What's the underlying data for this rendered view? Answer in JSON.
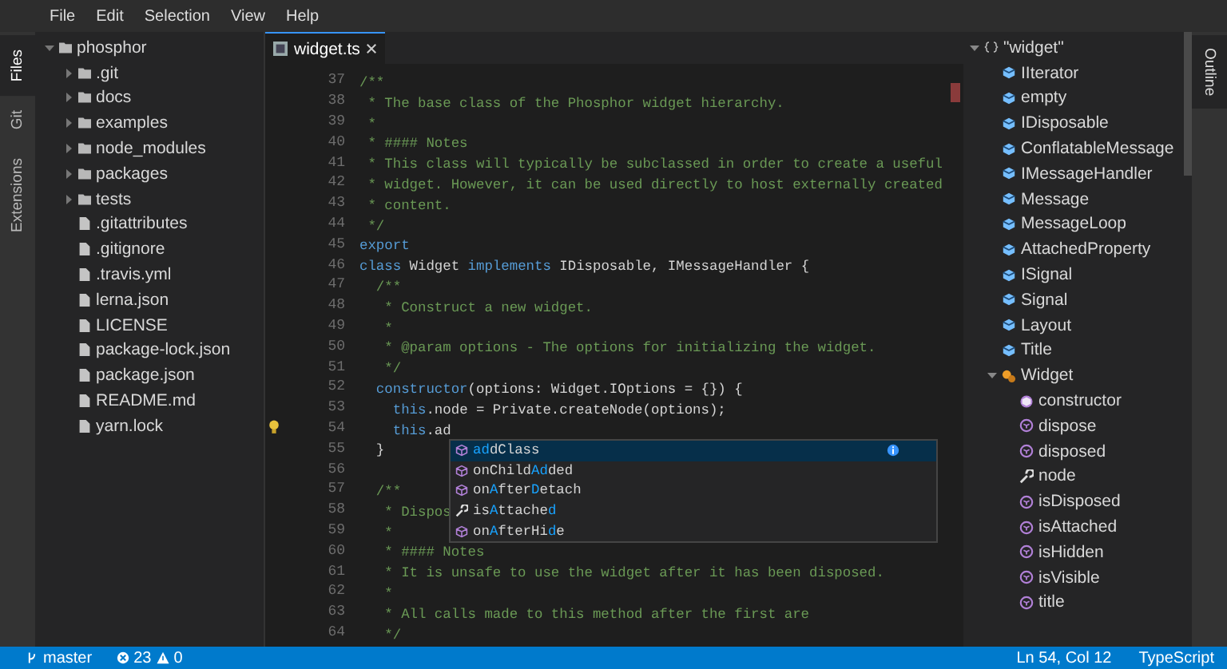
{
  "menu": [
    "File",
    "Edit",
    "Selection",
    "View",
    "Help"
  ],
  "activity_tabs": [
    {
      "label": "Files",
      "selected": true
    },
    {
      "label": "Git",
      "selected": false
    },
    {
      "label": "Extensions",
      "selected": false
    }
  ],
  "explorer": {
    "name": "phosphor",
    "kind": "folder",
    "expanded": true,
    "children": [
      {
        "name": ".git",
        "kind": "folder",
        "expanded": false
      },
      {
        "name": "docs",
        "kind": "folder",
        "expanded": false
      },
      {
        "name": "examples",
        "kind": "folder",
        "expanded": false
      },
      {
        "name": "node_modules",
        "kind": "folder",
        "expanded": false
      },
      {
        "name": "packages",
        "kind": "folder",
        "expanded": false
      },
      {
        "name": "tests",
        "kind": "folder",
        "expanded": false
      },
      {
        "name": ".gitattributes",
        "kind": "file"
      },
      {
        "name": ".gitignore",
        "kind": "file"
      },
      {
        "name": ".travis.yml",
        "kind": "file"
      },
      {
        "name": "lerna.json",
        "kind": "file"
      },
      {
        "name": "LICENSE",
        "kind": "file"
      },
      {
        "name": "package-lock.json",
        "kind": "file"
      },
      {
        "name": "package.json",
        "kind": "file"
      },
      {
        "name": "README.md",
        "kind": "file"
      },
      {
        "name": "yarn.lock",
        "kind": "file"
      }
    ]
  },
  "editor": {
    "tabs": [
      {
        "label": "widget.ts",
        "selected": true
      }
    ],
    "lines": [
      {
        "number": "37",
        "lightbulb": false,
        "tokens": [
          {
            "text": "/**",
            "kind": "comment"
          }
        ]
      },
      {
        "number": "38",
        "lightbulb": false,
        "tokens": [
          {
            "text": " * The base class of the Phosphor widget hierarchy.",
            "kind": "comment"
          }
        ]
      },
      {
        "number": "39",
        "lightbulb": false,
        "tokens": [
          {
            "text": " *",
            "kind": "comment"
          }
        ]
      },
      {
        "number": "40",
        "lightbulb": false,
        "tokens": [
          {
            "text": " * #### Notes",
            "kind": "comment"
          }
        ]
      },
      {
        "number": "41",
        "lightbulb": false,
        "tokens": [
          {
            "text": " * This class will typically be subclassed in order to create a useful",
            "kind": "comment"
          }
        ]
      },
      {
        "number": "42",
        "lightbulb": false,
        "tokens": [
          {
            "text": " * widget. However, it can be used directly to host externally created",
            "kind": "comment"
          }
        ]
      },
      {
        "number": "43",
        "lightbulb": false,
        "tokens": [
          {
            "text": " * content.",
            "kind": "comment"
          }
        ]
      },
      {
        "number": "44",
        "lightbulb": false,
        "tokens": [
          {
            "text": " */",
            "kind": "comment"
          }
        ]
      },
      {
        "number": "45",
        "lightbulb": false,
        "tokens": [
          {
            "text": "export",
            "kind": "keyword"
          }
        ]
      },
      {
        "number": "46",
        "lightbulb": false,
        "tokens": [
          {
            "text": "class",
            "kind": "keyword"
          },
          {
            "text": " Widget ",
            "kind": "plain"
          },
          {
            "text": "implements",
            "kind": "keyword"
          },
          {
            "text": " IDisposable, IMessageHandler {",
            "kind": "plain"
          }
        ]
      },
      {
        "number": "47",
        "lightbulb": false,
        "tokens": [
          {
            "text": "  /**",
            "kind": "comment"
          }
        ]
      },
      {
        "number": "48",
        "lightbulb": false,
        "tokens": [
          {
            "text": "   * Construct a new widget.",
            "kind": "comment"
          }
        ]
      },
      {
        "number": "49",
        "lightbulb": false,
        "tokens": [
          {
            "text": "   *",
            "kind": "comment"
          }
        ]
      },
      {
        "number": "50",
        "lightbulb": false,
        "tokens": [
          {
            "text": "   * @param options - The options for initializing the widget.",
            "kind": "comment"
          }
        ]
      },
      {
        "number": "51",
        "lightbulb": false,
        "tokens": [
          {
            "text": "   */",
            "kind": "comment"
          }
        ]
      },
      {
        "number": "52",
        "lightbulb": false,
        "tokens": [
          {
            "text": "  constructor",
            "kind": "keyword"
          },
          {
            "text": "(options: Widget.IOptions = {}) {",
            "kind": "plain"
          }
        ]
      },
      {
        "number": "53",
        "lightbulb": false,
        "tokens": [
          {
            "text": "    this",
            "kind": "keyword"
          },
          {
            "text": ".node = Private.createNode(options);",
            "kind": "plain"
          }
        ]
      },
      {
        "number": "54",
        "lightbulb": true,
        "tokens": [
          {
            "text": "    this",
            "kind": "keyword"
          },
          {
            "text": ".ad",
            "kind": "plain"
          }
        ]
      },
      {
        "number": "55",
        "lightbulb": false,
        "tokens": [
          {
            "text": "  }",
            "kind": "plain"
          }
        ]
      },
      {
        "number": "56",
        "lightbulb": false
      },
      {
        "number": "57",
        "lightbulb": false,
        "tokens": [
          {
            "text": "  /**",
            "kind": "comment"
          }
        ]
      },
      {
        "number": "58",
        "lightbulb": false,
        "tokens": [
          {
            "text": "   * Dispos",
            "kind": "comment"
          }
        ]
      },
      {
        "number": "59",
        "lightbulb": false,
        "tokens": [
          {
            "text": "   *",
            "kind": "comment"
          }
        ]
      },
      {
        "number": "60",
        "lightbulb": false,
        "tokens": [
          {
            "text": "   * #### Notes",
            "kind": "comment"
          }
        ]
      },
      {
        "number": "61",
        "lightbulb": false,
        "tokens": [
          {
            "text": "   * It is unsafe to use the widget after it has been disposed.",
            "kind": "comment"
          }
        ]
      },
      {
        "number": "62",
        "lightbulb": false,
        "tokens": [
          {
            "text": "   *",
            "kind": "comment"
          }
        ]
      },
      {
        "number": "63",
        "lightbulb": false,
        "tokens": [
          {
            "text": "   * All calls made to this method after the first are",
            "kind": "comment"
          }
        ]
      },
      {
        "number": "64",
        "lightbulb": false,
        "tokens": [
          {
            "text": "   */",
            "kind": "comment"
          }
        ]
      }
    ],
    "completions": [
      {
        "kind": "method",
        "selected": true,
        "segments": [
          {
            "text": "ad",
            "match": true
          },
          {
            "text": "dClass",
            "match": false
          }
        ]
      },
      {
        "kind": "method",
        "selected": false,
        "segments": [
          {
            "text": "onChild",
            "match": false
          },
          {
            "text": "Ad",
            "match": true
          },
          {
            "text": "ded",
            "match": false
          }
        ]
      },
      {
        "kind": "method",
        "selected": false,
        "segments": [
          {
            "text": "on",
            "match": false
          },
          {
            "text": "A",
            "match": true
          },
          {
            "text": "fter",
            "match": false
          },
          {
            "text": "D",
            "match": true
          },
          {
            "text": "etach",
            "match": false
          }
        ]
      },
      {
        "kind": "property",
        "selected": false,
        "segments": [
          {
            "text": "is",
            "match": false
          },
          {
            "text": "A",
            "match": true
          },
          {
            "text": "ttache",
            "match": false
          },
          {
            "text": "d",
            "match": true
          }
        ]
      },
      {
        "kind": "method",
        "selected": false,
        "segments": [
          {
            "text": "on",
            "match": false
          },
          {
            "text": "A",
            "match": true
          },
          {
            "text": "fterHi",
            "match": false
          },
          {
            "text": "d",
            "match": true
          },
          {
            "text": "e",
            "match": false
          }
        ]
      }
    ]
  },
  "outline": {
    "name": "\"widget\"",
    "kind": "module-root",
    "expanded": true,
    "children": [
      {
        "name": "IIterator",
        "kind": "module"
      },
      {
        "name": "empty",
        "kind": "module"
      },
      {
        "name": "IDisposable",
        "kind": "module"
      },
      {
        "name": "ConflatableMessage",
        "kind": "module"
      },
      {
        "name": "IMessageHandler",
        "kind": "module"
      },
      {
        "name": "Message",
        "kind": "module"
      },
      {
        "name": "MessageLoop",
        "kind": "module"
      },
      {
        "name": "AttachedProperty",
        "kind": "module"
      },
      {
        "name": "ISignal",
        "kind": "module"
      },
      {
        "name": "Signal",
        "kind": "module"
      },
      {
        "name": "Layout",
        "kind": "module"
      },
      {
        "name": "Title",
        "kind": "module"
      },
      {
        "name": "Widget",
        "kind": "class",
        "expanded": true,
        "children": [
          {
            "name": "constructor",
            "kind": "constructor"
          },
          {
            "name": "dispose",
            "kind": "method"
          },
          {
            "name": "disposed",
            "kind": "method"
          },
          {
            "name": "node",
            "kind": "property"
          },
          {
            "name": "isDisposed",
            "kind": "method"
          },
          {
            "name": "isAttached",
            "kind": "method"
          },
          {
            "name": "isHidden",
            "kind": "method"
          },
          {
            "name": "isVisible",
            "kind": "method"
          },
          {
            "name": "title",
            "kind": "method"
          }
        ]
      }
    ]
  },
  "side_tab": {
    "label": "Outline"
  },
  "status_bar": {
    "branch": "master",
    "errors": "23",
    "warnings": "0",
    "position": "Ln 54, Col 12",
    "language": "TypeScript"
  }
}
